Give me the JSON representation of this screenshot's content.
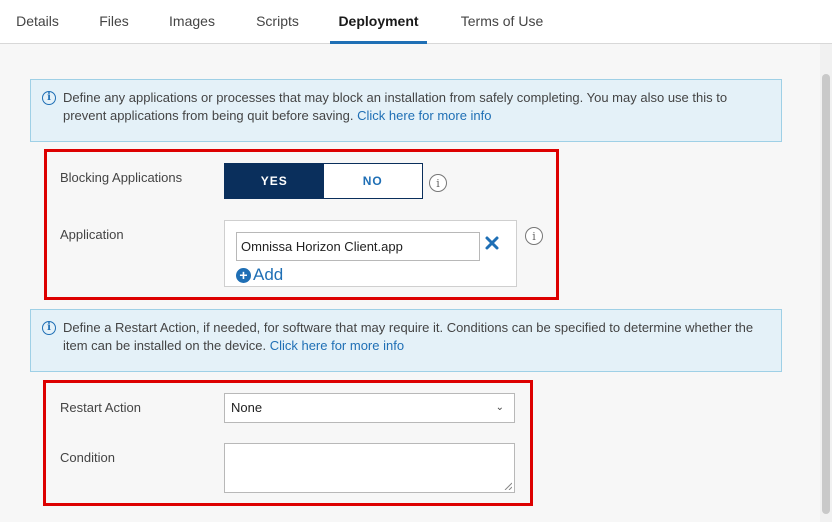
{
  "tabs": [
    {
      "label": "Details"
    },
    {
      "label": "Files"
    },
    {
      "label": "Images"
    },
    {
      "label": "Scripts"
    },
    {
      "label": "Deployment"
    },
    {
      "label": "Terms of Use"
    }
  ],
  "active_tab": "Deployment",
  "blocking_info": {
    "text": "Define any applications or processes that may block an installation from safely completing. You may also use this to prevent applications from being quit before saving. ",
    "link": "Click here for more info"
  },
  "blocking_applications": {
    "label": "Blocking Applications",
    "yes_label": "YES",
    "no_label": "NO",
    "selected": "YES"
  },
  "application": {
    "label": "Application",
    "value": "Omnissa Horizon Client.app",
    "add_label": "Add"
  },
  "restart_info": {
    "text": "Define a Restart Action, if needed, for software that may require it. Conditions can be specified to determine whether the item can be installed on the device. ",
    "link": "Click here for more info"
  },
  "restart_action": {
    "label": "Restart Action",
    "value": "None"
  },
  "condition": {
    "label": "Condition",
    "value": ""
  },
  "colors": {
    "accent": "#1f6fb5",
    "navy": "#0a2f5c",
    "highlight_red": "#dd0000",
    "info_bg": "#e4f1f8"
  }
}
